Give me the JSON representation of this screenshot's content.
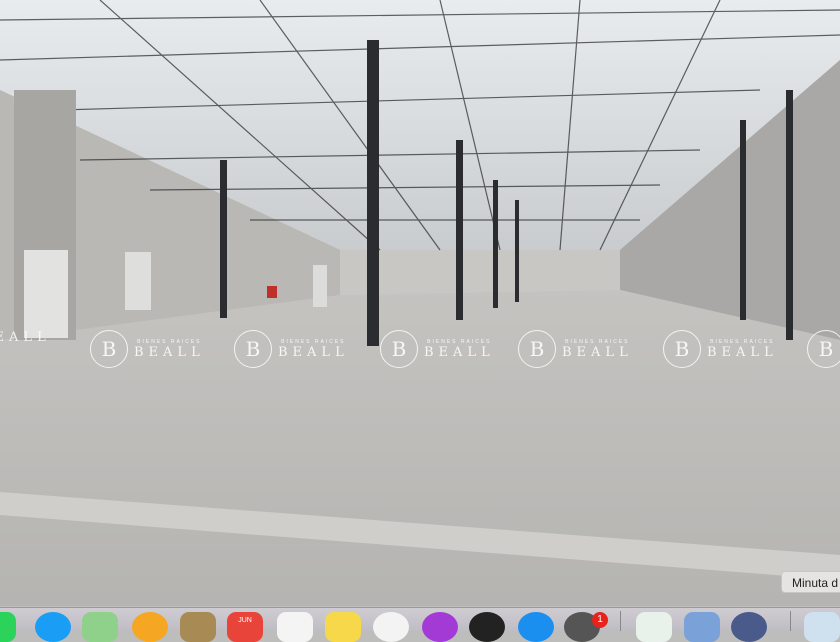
{
  "watermark": {
    "brand": "BEALL",
    "tagline": "BIENES RAICES",
    "logo_letter": "B"
  },
  "tooltip": "Minuta d",
  "dock": {
    "calendar_month": "JUN",
    "system_prefs_badge": "1",
    "apps": [
      "facetime",
      "safari",
      "maps",
      "photos",
      "contacts",
      "calendar",
      "reminders",
      "notes",
      "music",
      "podcasts",
      "tv",
      "app-store",
      "system-preferences",
      "numbers",
      "preview",
      "screenshot",
      "trash"
    ]
  }
}
